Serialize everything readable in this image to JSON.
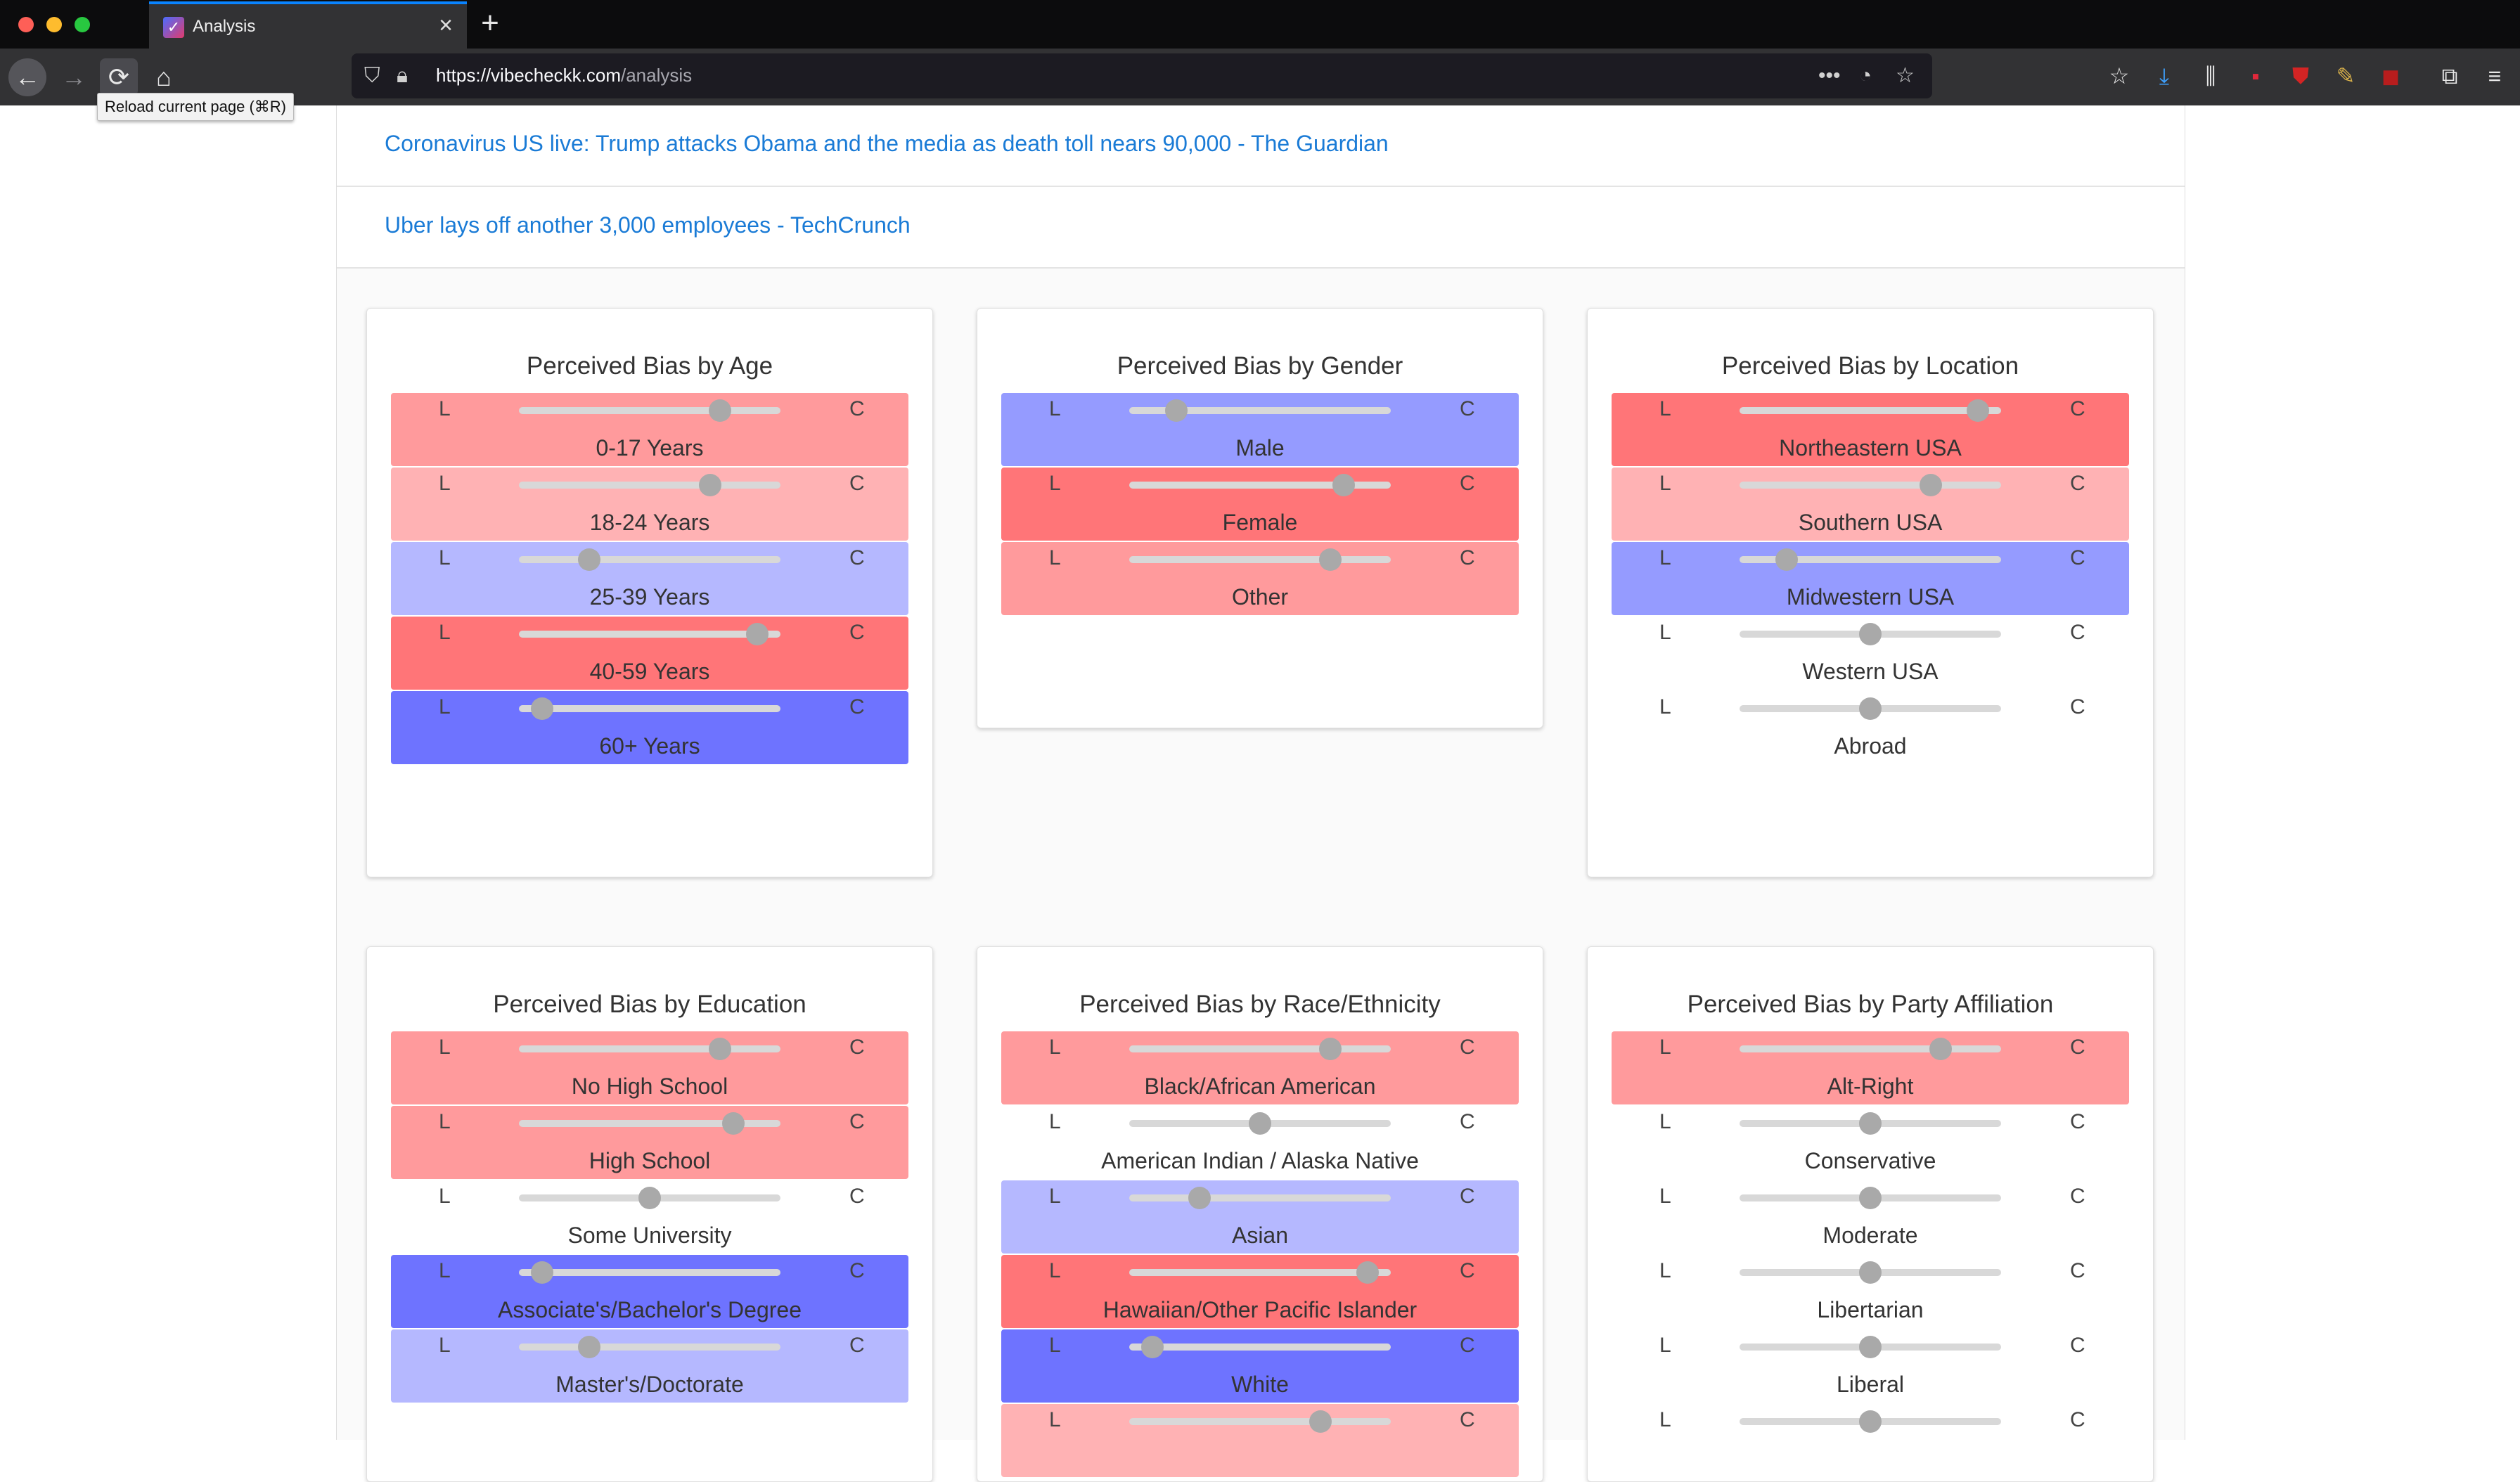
{
  "browser": {
    "tab_title": "Analysis",
    "url_host": "https://vibecheckk.com",
    "url_path": "/analysis",
    "tooltip": "Reload current page (⌘R)"
  },
  "news": [
    {
      "text": "Coronavirus US live: Trump attacks Obama and the media as death toll nears 90,000 - The Guardian"
    },
    {
      "text": "Uber lays off another 3,000 employees - TechCrunch"
    }
  ],
  "scale": {
    "left": "L",
    "right": "C"
  },
  "colors": {
    "left_strong": "#6e73ff",
    "left_mid": "#959bff",
    "left_light": "#b5b8ff",
    "right_strong": "#ff7578",
    "right_mid": "#ff9a9c",
    "right_light": "#ffb2b4",
    "neutral": "#ffffff",
    "link": "#1a7bd6",
    "thumb": "#a9a9a9"
  },
  "cards": [
    {
      "title": "Perceived Bias by Age",
      "rows": [
        {
          "label": "0-17 Years",
          "value": 0.77,
          "color": "right_mid"
        },
        {
          "label": "18-24 Years",
          "value": 0.73,
          "color": "right_light"
        },
        {
          "label": "25-39 Years",
          "value": 0.27,
          "color": "left_light"
        },
        {
          "label": "40-59 Years",
          "value": 0.91,
          "color": "right_strong"
        },
        {
          "label": "60+ Years",
          "value": 0.09,
          "color": "left_strong"
        }
      ]
    },
    {
      "title": "Perceived Bias by Gender",
      "rows": [
        {
          "label": "Male",
          "value": 0.18,
          "color": "left_mid"
        },
        {
          "label": "Female",
          "value": 0.82,
          "color": "right_strong"
        },
        {
          "label": "Other",
          "value": 0.77,
          "color": "right_mid"
        }
      ]
    },
    {
      "title": "Perceived Bias by Location",
      "rows": [
        {
          "label": "Northeastern USA",
          "value": 0.91,
          "color": "right_strong"
        },
        {
          "label": "Southern USA",
          "value": 0.73,
          "color": "right_light"
        },
        {
          "label": "Midwestern USA",
          "value": 0.18,
          "color": "left_mid"
        },
        {
          "label": "Western USA",
          "value": 0.5,
          "color": "neutral"
        },
        {
          "label": "Abroad",
          "value": 0.5,
          "color": "neutral"
        }
      ]
    },
    {
      "title": "Perceived Bias by Education",
      "rows": [
        {
          "label": "No High School",
          "value": 0.77,
          "color": "right_mid"
        },
        {
          "label": "High School",
          "value": 0.82,
          "color": "right_mid"
        },
        {
          "label": "Some University",
          "value": 0.5,
          "color": "neutral"
        },
        {
          "label": "Associate's/Bachelor's Degree",
          "value": 0.09,
          "color": "left_strong"
        },
        {
          "label": "Master's/Doctorate",
          "value": 0.27,
          "color": "left_light"
        }
      ]
    },
    {
      "title": "Perceived Bias by Race/Ethnicity",
      "rows": [
        {
          "label": "Black/African American",
          "value": 0.77,
          "color": "right_mid"
        },
        {
          "label": "American Indian / Alaska Native",
          "value": 0.5,
          "color": "neutral"
        },
        {
          "label": "Asian",
          "value": 0.27,
          "color": "left_light"
        },
        {
          "label": "Hawaiian/Other Pacific Islander",
          "value": 0.91,
          "color": "right_strong"
        },
        {
          "label": "White",
          "value": 0.09,
          "color": "left_strong"
        },
        {
          "label": "",
          "value": 0.73,
          "color": "right_light"
        }
      ]
    },
    {
      "title": "Perceived Bias by Party Affiliation",
      "rows": [
        {
          "label": "Alt-Right",
          "value": 0.77,
          "color": "right_mid"
        },
        {
          "label": "Conservative",
          "value": 0.5,
          "color": "neutral"
        },
        {
          "label": "Moderate",
          "value": 0.5,
          "color": "neutral"
        },
        {
          "label": "Libertarian",
          "value": 0.5,
          "color": "neutral"
        },
        {
          "label": "Liberal",
          "value": 0.5,
          "color": "neutral"
        },
        {
          "label": "",
          "value": 0.5,
          "color": "neutral"
        }
      ]
    }
  ]
}
